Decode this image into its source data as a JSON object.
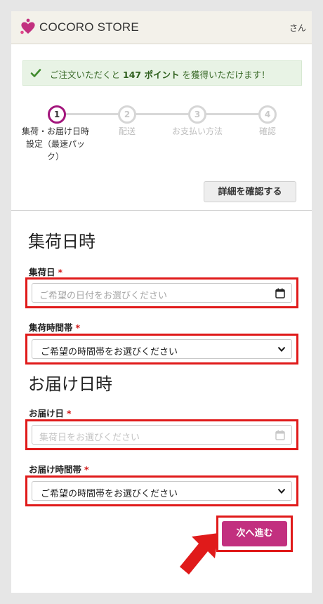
{
  "header": {
    "store_name": "COCORO STORE",
    "user_suffix": "さん",
    "brand_color": "#c2307f"
  },
  "notice": {
    "before": "ご注文いただくと",
    "points": "147 ポイント",
    "after": "を獲得いただけます！",
    "icon": "check-icon"
  },
  "stepper": {
    "steps": [
      {
        "number": "1",
        "label_lines": [
          "集荷・お届け日時",
          "設定（最速パッ",
          "ク）"
        ],
        "active": true
      },
      {
        "number": "2",
        "label_lines": [
          "配送"
        ],
        "active": false
      },
      {
        "number": "3",
        "label_lines": [
          "お支払い方法"
        ],
        "active": false
      },
      {
        "number": "4",
        "label_lines": [
          "確認"
        ],
        "active": false
      }
    ]
  },
  "confirm_details_label": "詳細を確認する",
  "pickup": {
    "section_title": "集荷日時",
    "date_label": "集荷日",
    "date_placeholder": "ご希望の日付をお選びください",
    "time_label": "集荷時間帯",
    "time_value": "ご希望の時間帯をお選びください"
  },
  "delivery": {
    "section_title": "お届け日時",
    "date_label": "お届け日",
    "date_placeholder": "集荷日をお選びください",
    "time_label": "お届け時間帯",
    "time_value": "ご希望の時間帯をお選びください"
  },
  "required_mark": "*",
  "next_label": "次へ進む",
  "colors": {
    "highlight": "#e01a1a",
    "active_step": "#a3167c",
    "notice_bg": "#e8f3e5"
  }
}
